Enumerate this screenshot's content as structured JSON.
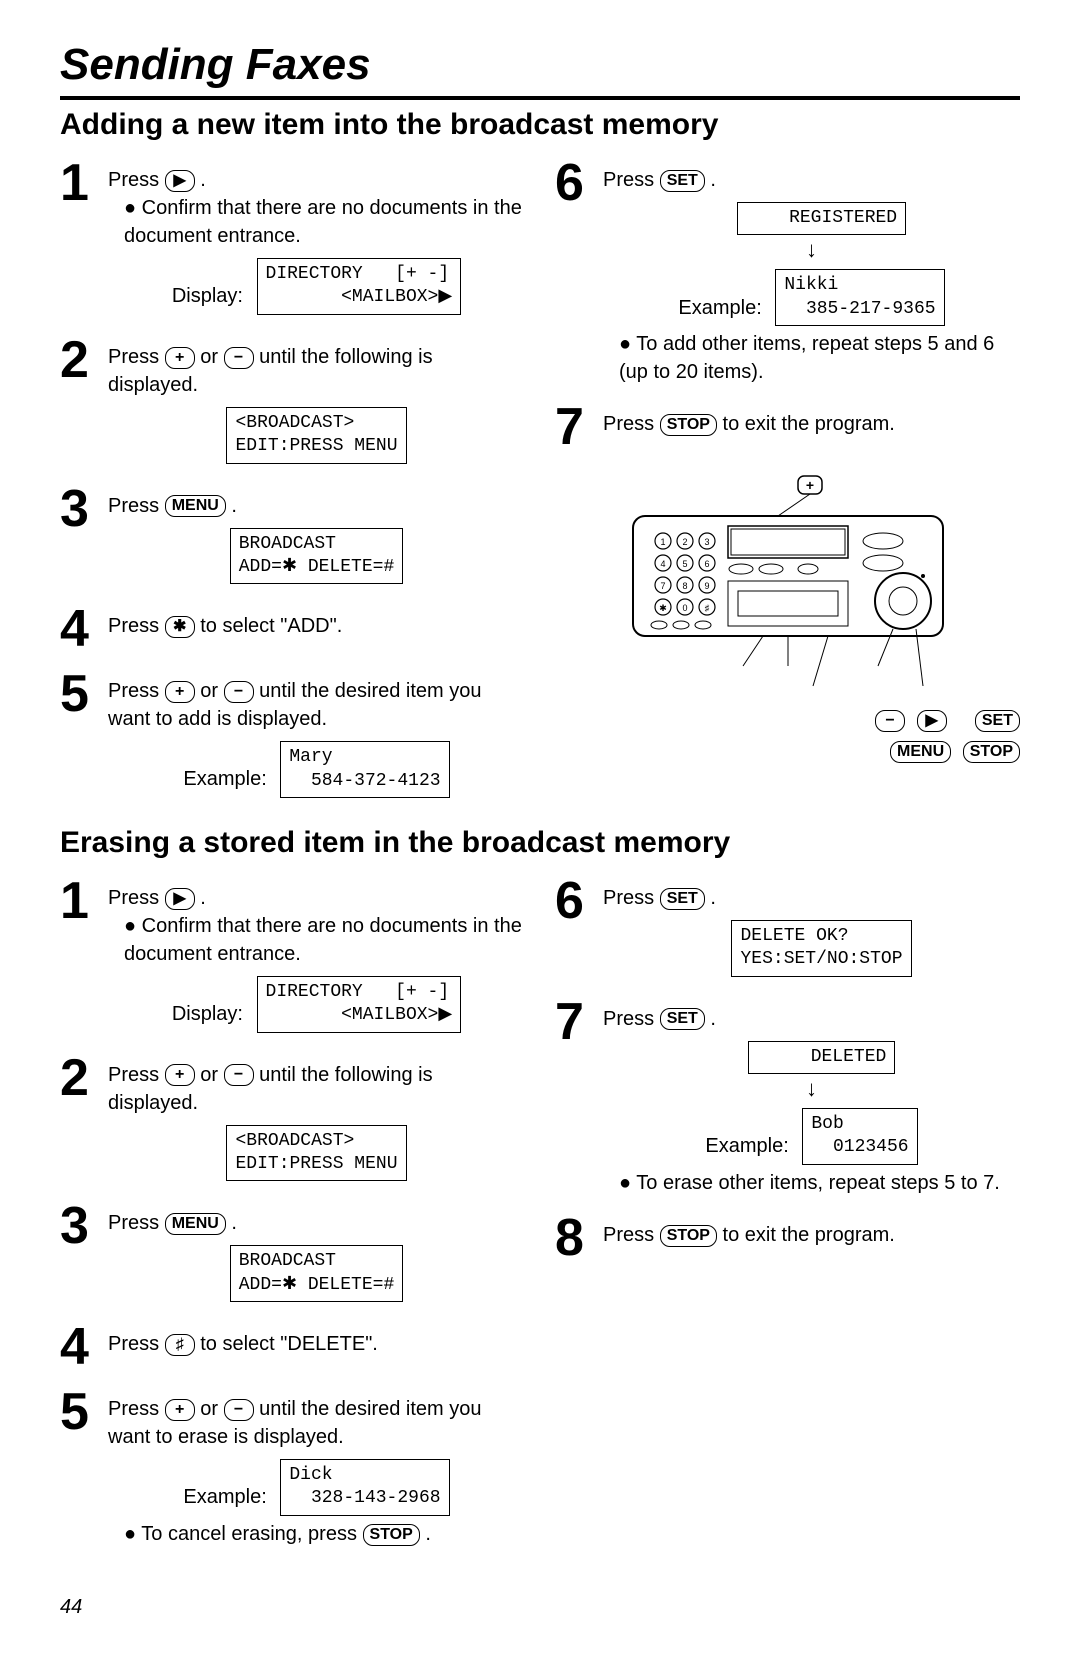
{
  "page": {
    "title": "Sending Faxes",
    "number": "44"
  },
  "add": {
    "heading": "Adding a new item into the broadcast memory",
    "s1": {
      "a": "Press ",
      "b": ".",
      "bullet": "Confirm that there are no documents in the document entrance.",
      "displayLabel": "Display:",
      "lcd": "DIRECTORY   [+ -]\n       <MAILBOX>▶"
    },
    "s2": {
      "a": "Press ",
      "or": " or ",
      "b": " until the following is displayed.",
      "lcd": "<BROADCAST>\nEDIT:PRESS MENU"
    },
    "s3": {
      "a": "Press ",
      "b": ".",
      "lcd": "BROADCAST\nADD=✱ DELETE=#"
    },
    "s4": {
      "a": "Press ",
      "b": " to select \"ADD\"."
    },
    "s5": {
      "a": "Press ",
      "or": " or ",
      "b": " until the desired item you want to add is displayed.",
      "exampleLabel": "Example:",
      "lcd": "Mary\n  584-372-4123"
    },
    "s6": {
      "a": "Press ",
      "b": ".",
      "lcd1": "    REGISTERED",
      "exampleLabel": "Example:",
      "lcd2": "Nikki\n  385-217-9365",
      "bullet": "To add other items, repeat steps 5 and 6 (up to 20 items)."
    },
    "s7": {
      "a": "Press ",
      "b": " to exit the program."
    }
  },
  "erase": {
    "heading": "Erasing a stored item in the broadcast memory",
    "s1": {
      "a": "Press ",
      "b": ".",
      "bullet": "Confirm that there are no documents in the document entrance.",
      "displayLabel": "Display:",
      "lcd": "DIRECTORY   [+ -]\n       <MAILBOX>▶"
    },
    "s2": {
      "a": "Press ",
      "or": " or ",
      "b": " until the following is displayed.",
      "lcd": "<BROADCAST>\nEDIT:PRESS MENU"
    },
    "s3": {
      "a": "Press ",
      "b": ".",
      "lcd": "BROADCAST\nADD=✱ DELETE=#"
    },
    "s4": {
      "a": "Press ",
      "b": " to select \"DELETE\"."
    },
    "s5": {
      "a": "Press ",
      "or": " or ",
      "b": " until the desired item you want to erase is displayed.",
      "exampleLabel": "Example:",
      "lcd": "Dick\n  328-143-2968",
      "cancel_a": "To cancel erasing, press ",
      "cancel_b": "."
    },
    "s6": {
      "a": "Press ",
      "b": ".",
      "lcd": "DELETE OK?\nYES:SET/NO:STOP"
    },
    "s7": {
      "a": "Press ",
      "b": ".",
      "lcd1": "     DELETED",
      "exampleLabel": "Example:",
      "lcd2": "Bob\n  0123456",
      "bullet": "To erase other items, repeat steps 5 to 7."
    },
    "s8": {
      "a": "Press ",
      "b": " to exit the program."
    }
  },
  "keys": {
    "play": "▶",
    "plus": "+",
    "minus": "−",
    "menu": "MENU",
    "star": "✱",
    "hash": "♯",
    "set": "SET",
    "stop": "STOP"
  }
}
